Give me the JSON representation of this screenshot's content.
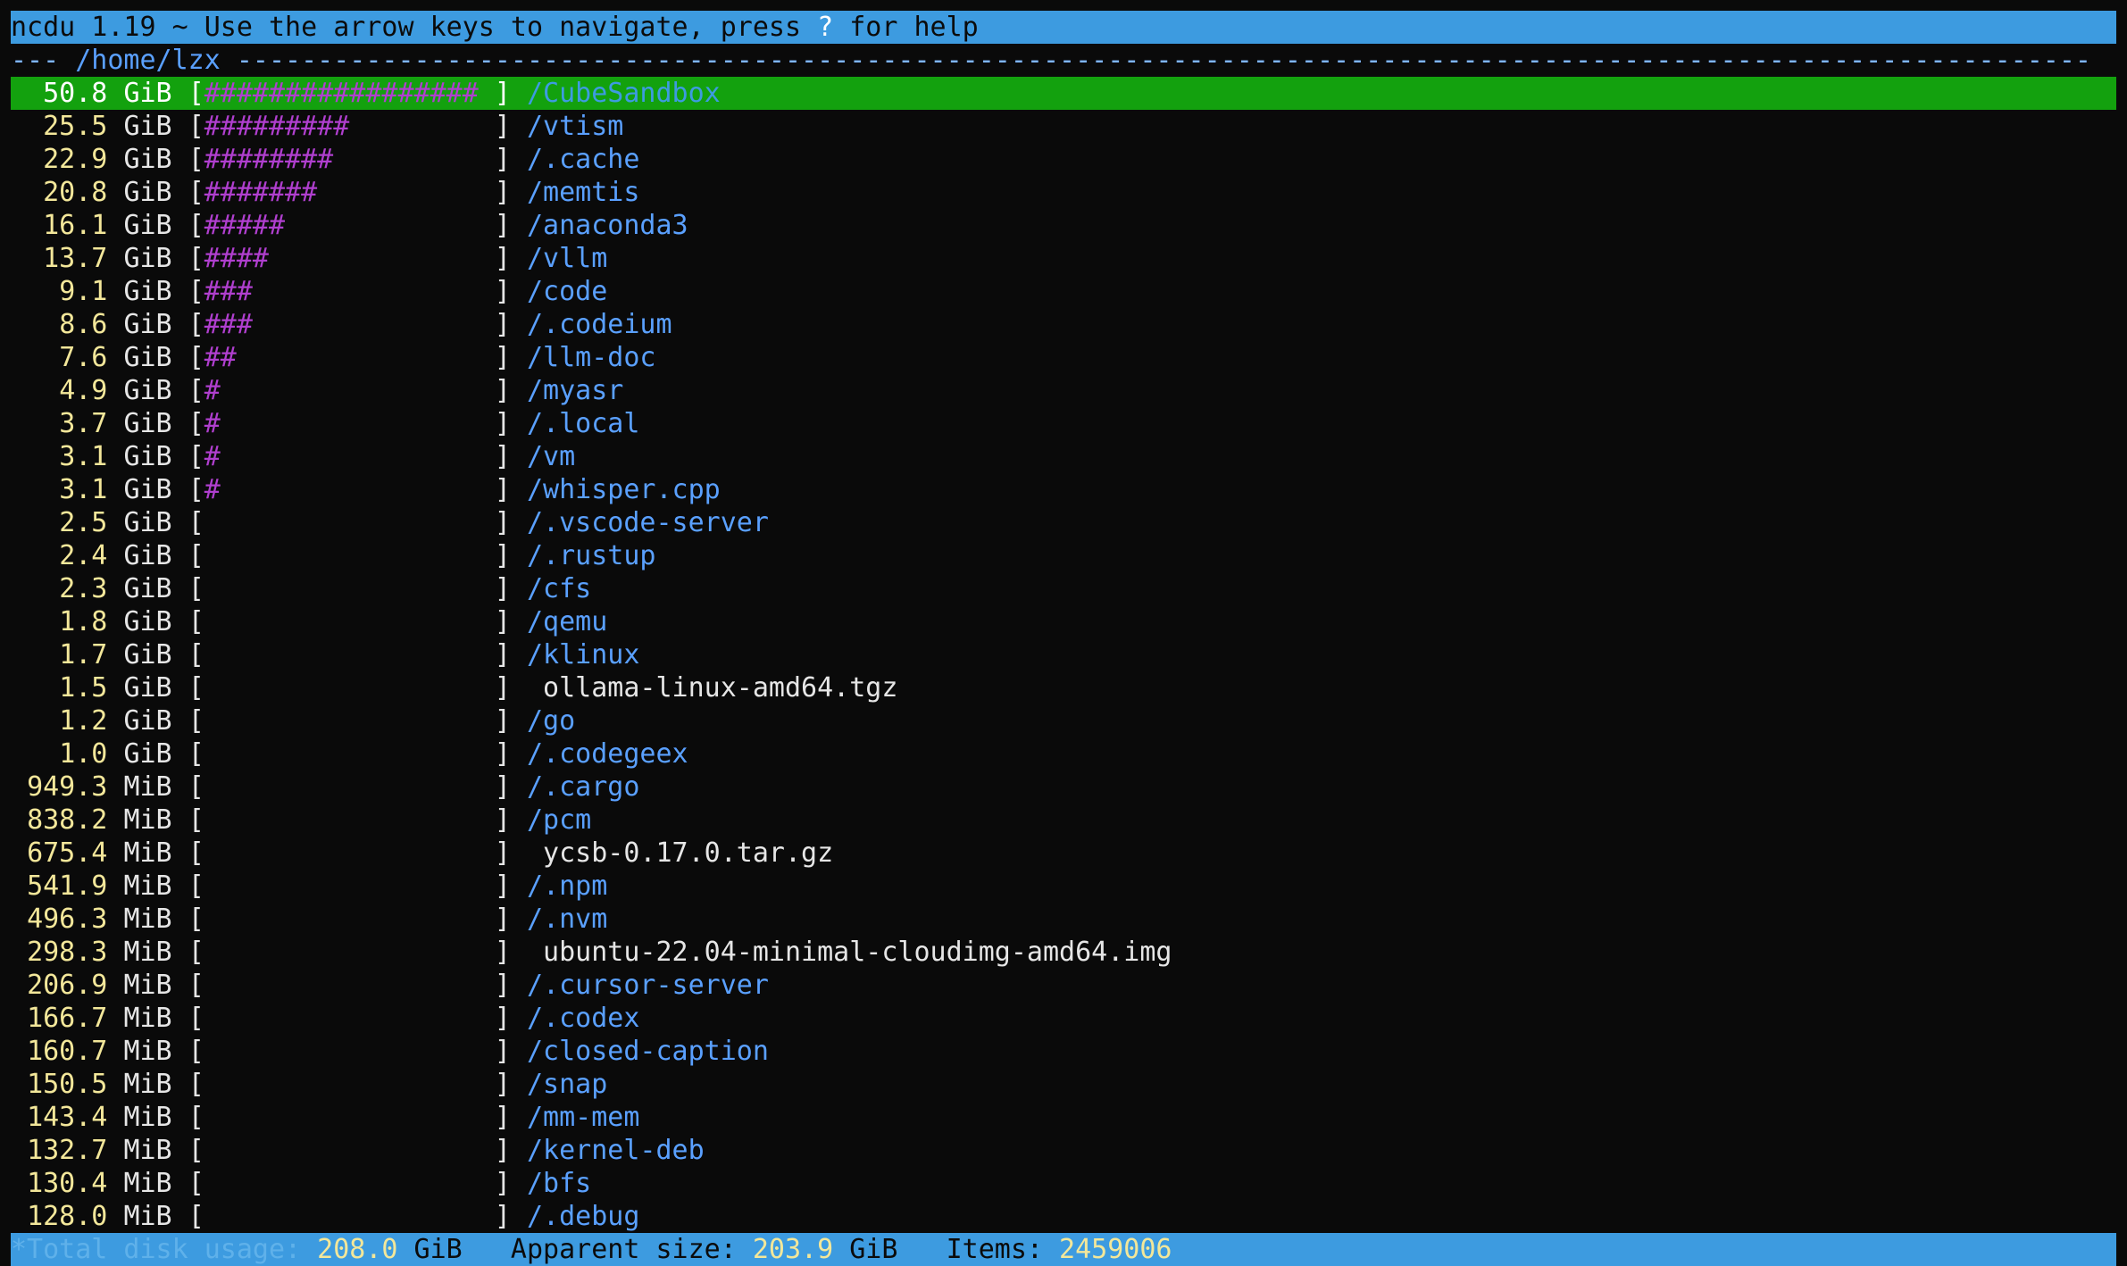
{
  "app": {
    "title_prefix": "ncdu 1.19 ~ Use the arrow keys to navigate, press ",
    "help_key": "?",
    "title_suffix": " for help"
  },
  "header": {
    "lead": "--- ",
    "path": "/home/lzx",
    "trail": " -------------------------------------------------------------------------------------------------------------------"
  },
  "colors": {
    "top_bar": "#3d9be0",
    "selected_row": "#13a10e",
    "size_text": "#f3e79a",
    "bar_hashes": "#b03fcf",
    "directory": "#5aa0ff"
  },
  "entries": [
    {
      "size": "50.8",
      "unit": "GiB",
      "bar": "#################",
      "name": "/CubeSandbox",
      "type": "dir",
      "selected": true
    },
    {
      "size": "25.5",
      "unit": "GiB",
      "bar": "#########",
      "name": "/vtism",
      "type": "dir"
    },
    {
      "size": "22.9",
      "unit": "GiB",
      "bar": "########",
      "name": "/.cache",
      "type": "dir"
    },
    {
      "size": "20.8",
      "unit": "GiB",
      "bar": "#######",
      "name": "/memtis",
      "type": "dir"
    },
    {
      "size": "16.1",
      "unit": "GiB",
      "bar": "#####",
      "name": "/anaconda3",
      "type": "dir"
    },
    {
      "size": "13.7",
      "unit": "GiB",
      "bar": "####",
      "name": "/vllm",
      "type": "dir"
    },
    {
      "size": "9.1",
      "unit": "GiB",
      "bar": "###",
      "name": "/code",
      "type": "dir"
    },
    {
      "size": "8.6",
      "unit": "GiB",
      "bar": "###",
      "name": "/.codeium",
      "type": "dir"
    },
    {
      "size": "7.6",
      "unit": "GiB",
      "bar": "##",
      "name": "/llm-doc",
      "type": "dir"
    },
    {
      "size": "4.9",
      "unit": "GiB",
      "bar": "#",
      "name": "/myasr",
      "type": "dir"
    },
    {
      "size": "3.7",
      "unit": "GiB",
      "bar": "#",
      "name": "/.local",
      "type": "dir"
    },
    {
      "size": "3.1",
      "unit": "GiB",
      "bar": "#",
      "name": "/vm",
      "type": "dir"
    },
    {
      "size": "3.1",
      "unit": "GiB",
      "bar": "#",
      "name": "/whisper.cpp",
      "type": "dir"
    },
    {
      "size": "2.5",
      "unit": "GiB",
      "bar": "",
      "name": "/.vscode-server",
      "type": "dir"
    },
    {
      "size": "2.4",
      "unit": "GiB",
      "bar": "",
      "name": "/.rustup",
      "type": "dir"
    },
    {
      "size": "2.3",
      "unit": "GiB",
      "bar": "",
      "name": "/cfs",
      "type": "dir"
    },
    {
      "size": "1.8",
      "unit": "GiB",
      "bar": "",
      "name": "/qemu",
      "type": "dir"
    },
    {
      "size": "1.7",
      "unit": "GiB",
      "bar": "",
      "name": "/klinux",
      "type": "dir"
    },
    {
      "size": "1.5",
      "unit": "GiB",
      "bar": "",
      "name": "ollama-linux-amd64.tgz",
      "type": "file"
    },
    {
      "size": "1.2",
      "unit": "GiB",
      "bar": "",
      "name": "/go",
      "type": "dir"
    },
    {
      "size": "1.0",
      "unit": "GiB",
      "bar": "",
      "name": "/.codegeex",
      "type": "dir"
    },
    {
      "size": "949.3",
      "unit": "MiB",
      "bar": "",
      "name": "/.cargo",
      "type": "dir"
    },
    {
      "size": "838.2",
      "unit": "MiB",
      "bar": "",
      "name": "/pcm",
      "type": "dir"
    },
    {
      "size": "675.4",
      "unit": "MiB",
      "bar": "",
      "name": "ycsb-0.17.0.tar.gz",
      "type": "file"
    },
    {
      "size": "541.9",
      "unit": "MiB",
      "bar": "",
      "name": "/.npm",
      "type": "dir"
    },
    {
      "size": "496.3",
      "unit": "MiB",
      "bar": "",
      "name": "/.nvm",
      "type": "dir"
    },
    {
      "size": "298.3",
      "unit": "MiB",
      "bar": "",
      "name": "ubuntu-22.04-minimal-cloudimg-amd64.img",
      "type": "file"
    },
    {
      "size": "206.9",
      "unit": "MiB",
      "bar": "",
      "name": "/.cursor-server",
      "type": "dir"
    },
    {
      "size": "166.7",
      "unit": "MiB",
      "bar": "",
      "name": "/.codex",
      "type": "dir"
    },
    {
      "size": "160.7",
      "unit": "MiB",
      "bar": "",
      "name": "/closed-caption",
      "type": "dir"
    },
    {
      "size": "150.5",
      "unit": "MiB",
      "bar": "",
      "name": "/snap",
      "type": "dir"
    },
    {
      "size": "143.4",
      "unit": "MiB",
      "bar": "",
      "name": "/mm-mem",
      "type": "dir"
    },
    {
      "size": "132.7",
      "unit": "MiB",
      "bar": "",
      "name": "/kernel-deb",
      "type": "dir"
    },
    {
      "size": "130.4",
      "unit": "MiB",
      "bar": "",
      "name": "/bfs",
      "type": "dir"
    },
    {
      "size": "128.0",
      "unit": "MiB",
      "bar": "",
      "name": "/.debug",
      "type": "dir"
    }
  ],
  "footer": {
    "total_label": "*Total disk usage: ",
    "total_value": "208.0",
    "total_unit": " GiB",
    "apparent_label": "   Apparent size: ",
    "apparent_value": "203.9",
    "apparent_unit": " GiB",
    "items_label": "   Items: ",
    "items_value": "2459006"
  }
}
